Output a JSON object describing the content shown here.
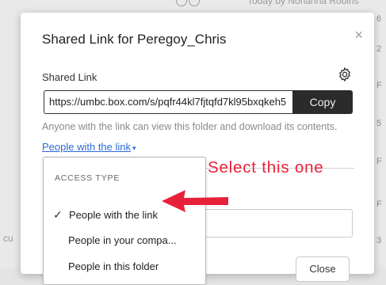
{
  "background": {
    "top_text": "Today by Norianna Robins",
    "left_text": "cu",
    "right_fragments": [
      "6",
      "2",
      "F",
      "5",
      "F",
      "F",
      "3"
    ]
  },
  "dialog": {
    "title": "Shared Link for Peregoy_Chris",
    "close_icon": "×",
    "shared_link_label": "Shared Link",
    "url_value": "https://umbc.box.com/s/pqfr44kl7fjtqfd7kl95bxqkeh5",
    "copy_label": "Copy",
    "description": "Anyone with the link can view this folder and download its contents.",
    "access_link_label": "People with the link",
    "access_caret": "▾",
    "close_button_label": "Close"
  },
  "dropdown": {
    "header": "ACCESS TYPE",
    "items": [
      {
        "label": "People with the link",
        "selected": true,
        "check": "✓"
      },
      {
        "label": "People in your compa...",
        "selected": false
      },
      {
        "label": "People in this folder",
        "selected": false
      }
    ]
  },
  "annotation": {
    "text": "Select this one",
    "color": "#e8213a"
  },
  "colors": {
    "accent_link": "#2c6bd6",
    "copy_button_bg": "#2b2b2b"
  }
}
